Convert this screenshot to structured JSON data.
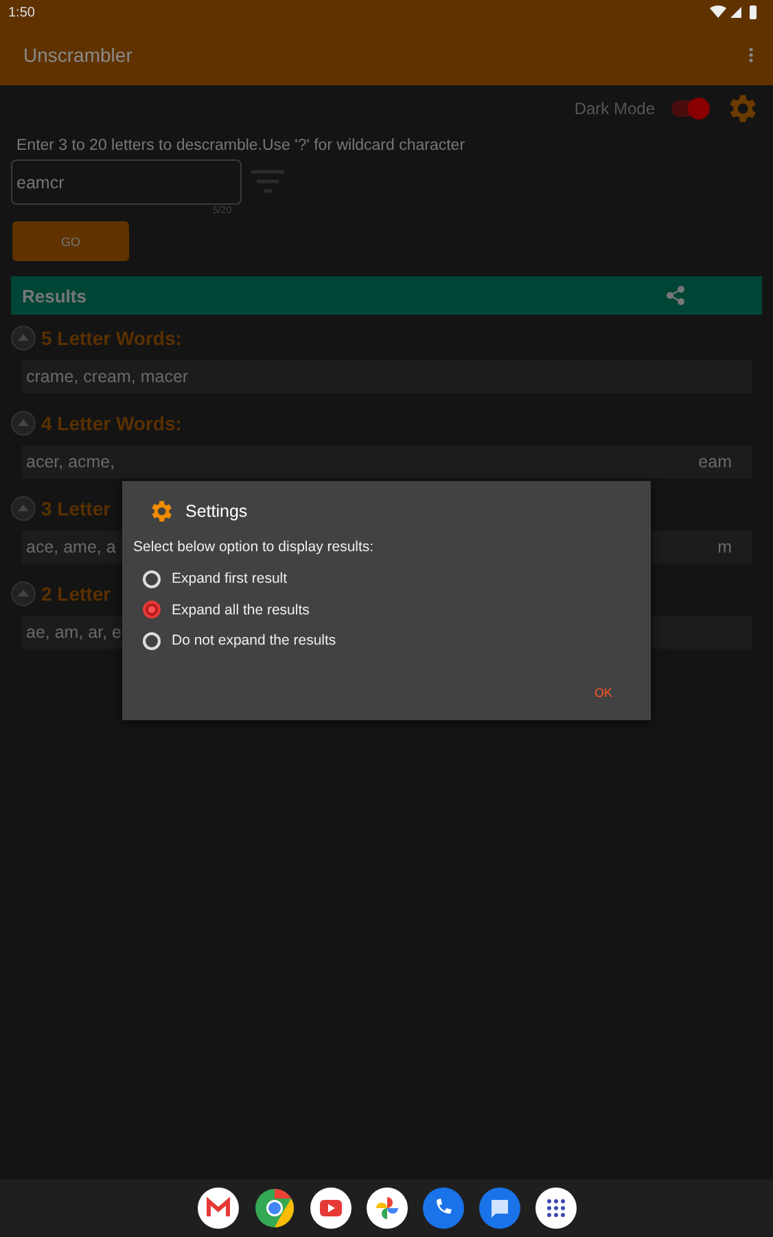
{
  "status_bar": {
    "time": "1:50"
  },
  "app_bar": {
    "title": "Unscrambler"
  },
  "dark_mode": {
    "label": "Dark Mode",
    "on": true
  },
  "instructions": "Enter 3 to 20 letters to descramble.Use '?' for wildcard character",
  "input": {
    "value": "eamcr",
    "counter": "5/20"
  },
  "go_button": "GO",
  "results": {
    "title": "Results"
  },
  "groups": [
    {
      "heading": "5 Letter Words:",
      "words_left": "crame, cream, macer"
    },
    {
      "heading": "4 Letter Words:",
      "words_left": "acer, acme,",
      "words_right": "eam"
    },
    {
      "heading": "3 Letter",
      "words_left": "ace, ame, a",
      "words_right": "m"
    },
    {
      "heading": "2 Letter",
      "words_left": "ae, am, ar, e"
    }
  ],
  "dialog": {
    "title": "Settings",
    "prompt": "Select below option to display results:",
    "options": [
      {
        "label": "Expand first result",
        "selected": false
      },
      {
        "label": "Expand all the results",
        "selected": true
      },
      {
        "label": "Do not expand the results",
        "selected": false
      }
    ],
    "ok": "OK"
  }
}
